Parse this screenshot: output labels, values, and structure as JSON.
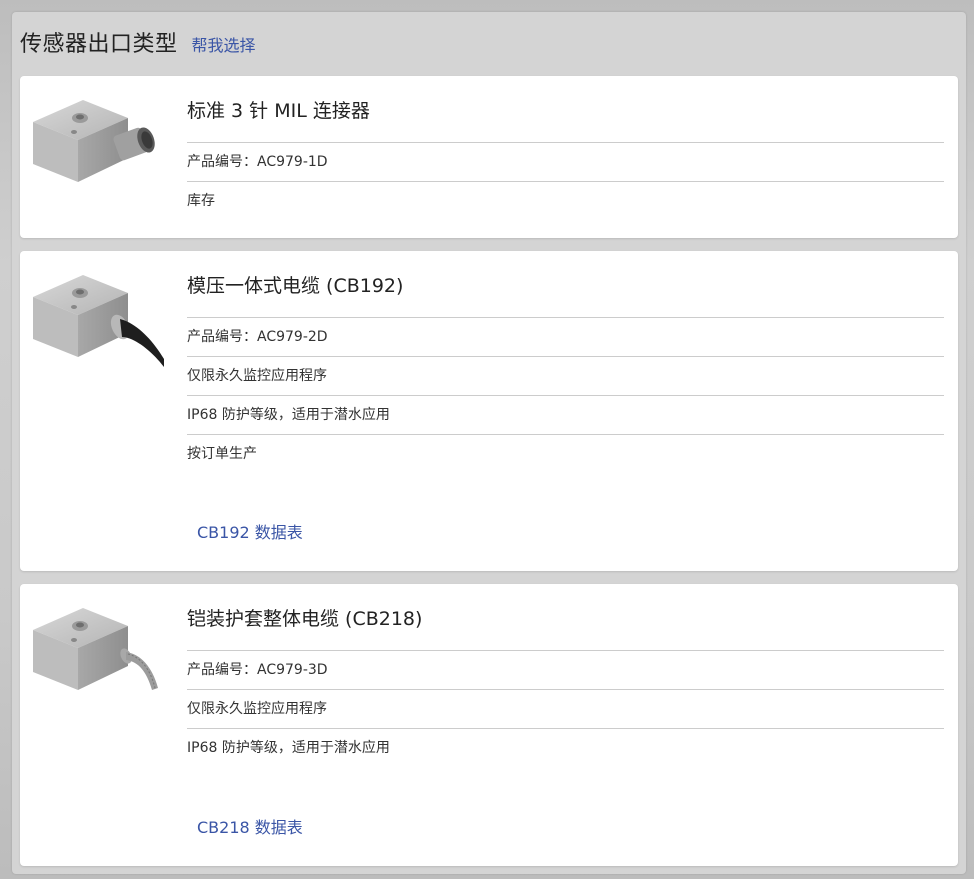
{
  "header": {
    "title": "传感器出口类型",
    "help_link": "帮我选择"
  },
  "cards": [
    {
      "title": "标准 3 针 MIL 连接器",
      "rows": [
        "产品编号：AC979-1D",
        "库存"
      ]
    },
    {
      "title": "模压一体式电缆 (CB192)",
      "rows": [
        "产品编号：AC979-2D",
        "仅限永久监控应用程序",
        "IP68 防护等级，适用于潜水应用",
        "按订单生产"
      ],
      "datasheet": "CB192 数据表"
    },
    {
      "title": "铠装护套整体电缆 (CB218)",
      "rows": [
        "产品编号：AC979-3D",
        "仅限永久监控应用程序",
        "IP68 防护等级，适用于潜水应用"
      ],
      "datasheet": "CB218 数据表"
    }
  ],
  "colors": {
    "link": "#3a55a6",
    "panel": "#d4d4d4",
    "card": "#ffffff"
  },
  "icons": [
    "sensor-mil-connector-image",
    "sensor-molded-cable-image",
    "sensor-armored-cable-image"
  ]
}
